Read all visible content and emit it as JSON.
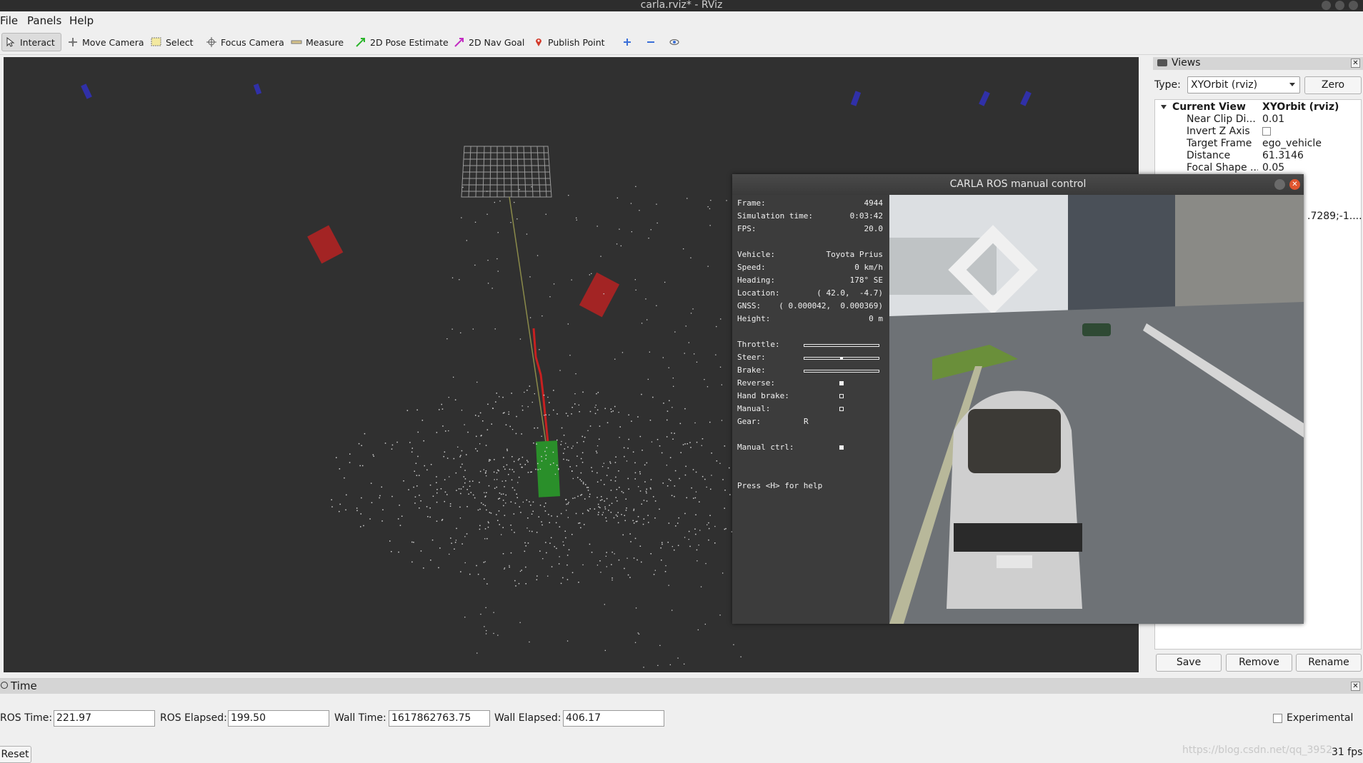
{
  "window": {
    "title": "carla.rviz* - RViz"
  },
  "menu": {
    "items": [
      "File",
      "Panels",
      "Help"
    ]
  },
  "toolbar": {
    "tools": [
      {
        "label": "Interact",
        "icon": "cursor-icon",
        "active": true
      },
      {
        "label": "Move Camera",
        "icon": "move-camera-icon"
      },
      {
        "label": "Select",
        "icon": "select-box-icon"
      },
      {
        "label": "Focus Camera",
        "icon": "focus-camera-icon"
      },
      {
        "label": "Measure",
        "icon": "measure-icon"
      },
      {
        "label": "2D Pose Estimate",
        "icon": "pose-estimate-arrow-icon"
      },
      {
        "label": "2D Nav Goal",
        "icon": "nav-goal-arrow-icon"
      },
      {
        "label": "Publish Point",
        "icon": "map-pin-icon"
      }
    ],
    "extra_icons": [
      "add-tool-icon",
      "remove-tool-icon",
      "eye-icon"
    ]
  },
  "views_panel": {
    "title": "Views",
    "type_label": "Type:",
    "type_value": "XYOrbit (rviz)",
    "zero_label": "Zero",
    "current_view": {
      "key": "Current View",
      "value": "XYOrbit (rviz)"
    },
    "properties": [
      {
        "key": "Near Clip Di...",
        "value": "0.01"
      },
      {
        "key": "Invert Z Axis",
        "value": ""
      },
      {
        "key": "Target Frame",
        "value": "ego_vehicle"
      },
      {
        "key": "Distance",
        "value": "61.3146"
      },
      {
        "key": "Focal Shape ...",
        "value": "0.05"
      }
    ],
    "partial_value": ".7289;-1....",
    "buttons": {
      "save": "Save",
      "remove": "Remove",
      "rename": "Rename"
    }
  },
  "time_panel": {
    "title": "Time",
    "ros_time_label": "ROS Time:",
    "ros_time": "221.97",
    "ros_elapsed_label": "ROS Elapsed:",
    "ros_elapsed": "199.50",
    "wall_time_label": "Wall Time:",
    "wall_time": "1617862763.75",
    "wall_elapsed_label": "Wall Elapsed:",
    "wall_elapsed": "406.17",
    "experimental_label": "Experimental",
    "reset_label": "Reset",
    "fps": "31 fps",
    "watermark": "https://blog.csdn.net/qq_3952"
  },
  "carla": {
    "title": "CARLA ROS manual control",
    "hud": {
      "frame_label": "Frame:",
      "frame": "4944",
      "sim_time_label": "Simulation time:",
      "sim_time": "0:03:42",
      "fps_label": "FPS:",
      "fps": "20.0",
      "vehicle_label": "Vehicle:",
      "vehicle": "Toyota Prius",
      "speed_label": "Speed:",
      "speed": "0 km/h",
      "heading_label": "Heading:",
      "heading": "178° SE",
      "location_label": "Location:",
      "location": "( 42.0,  -4.7)",
      "gnss_label": "GNSS:",
      "gnss": "( 0.000042,  0.000369)",
      "height_label": "Height:",
      "height": "0 m",
      "throttle_label": "Throttle:",
      "throttle": 0.0,
      "steer_label": "Steer:",
      "steer": 0.0,
      "brake_label": "Brake:",
      "brake": 0.0,
      "reverse_label": "Reverse:",
      "reverse": true,
      "handbrake_label": "Hand brake:",
      "handbrake": false,
      "manual_label": "Manual:",
      "manual": false,
      "gear_label": "Gear:",
      "gear": "R",
      "manual_ctrl_label": "Manual ctrl:",
      "manual_ctrl": true,
      "help": "Press <H> for help"
    }
  },
  "colors": {
    "grid": "#a0a0a0",
    "marker_red": "#b02424",
    "ego_green": "#2a8f2a",
    "marker_blue": "#2a2ab0",
    "view_bg": "#303030"
  }
}
